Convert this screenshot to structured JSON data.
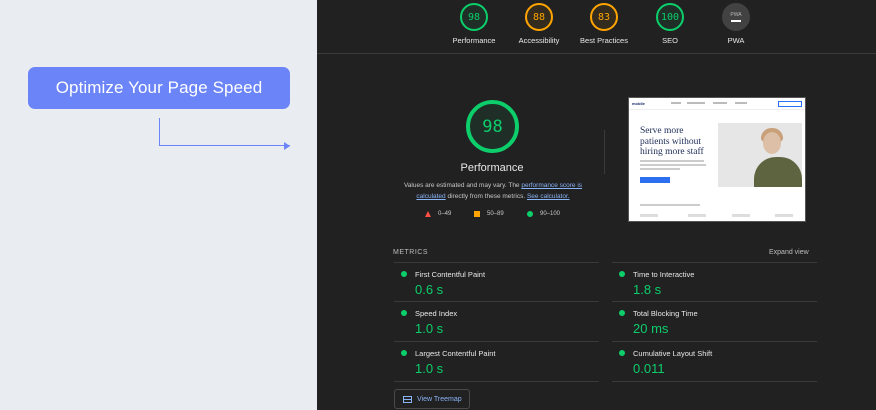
{
  "promo": {
    "button_label": "Optimize Your Page Speed"
  },
  "score_bar": [
    {
      "label": "Performance",
      "score": "98",
      "status": "good"
    },
    {
      "label": "Accessibility",
      "score": "88",
      "status": "average"
    },
    {
      "label": "Best Practices",
      "score": "83",
      "status": "average"
    },
    {
      "label": "SEO",
      "score": "100",
      "status": "good"
    },
    {
      "label": "PWA",
      "badge_text": "PWA",
      "score": "—",
      "status": "na"
    }
  ],
  "performance": {
    "score": "98",
    "title": "Performance",
    "desc_prefix": "Values are estimated and may vary. The ",
    "desc_link1": "performance score is calculated",
    "desc_middle": " directly from these metrics. ",
    "desc_link2": "See calculator."
  },
  "legend": [
    {
      "range": "0–49",
      "shape": "triangle"
    },
    {
      "range": "50–89",
      "shape": "square"
    },
    {
      "range": "90–100",
      "shape": "circle"
    }
  ],
  "screenshot": {
    "logo": "mobile",
    "hero_text": "Serve more patients without hiring more staff"
  },
  "metrics": {
    "header": "METRICS",
    "expand_label": "Expand view",
    "items": [
      {
        "label": "First Contentful Paint",
        "value": "0.6 s"
      },
      {
        "label": "Time to Interactive",
        "value": "1.8 s"
      },
      {
        "label": "Speed Index",
        "value": "1.0 s"
      },
      {
        "label": "Total Blocking Time",
        "value": "20 ms"
      },
      {
        "label": "Largest Contentful Paint",
        "value": "1.0 s"
      },
      {
        "label": "Cumulative Layout Shift",
        "value": "0.011"
      }
    ]
  },
  "treemap_label": "View Treemap",
  "colors": {
    "good": "#0cce6b",
    "average": "#ffa400",
    "fail": "#ff4e42",
    "accent": "#6b84f8",
    "link": "#8ab4f8",
    "report_bg": "#212121"
  }
}
